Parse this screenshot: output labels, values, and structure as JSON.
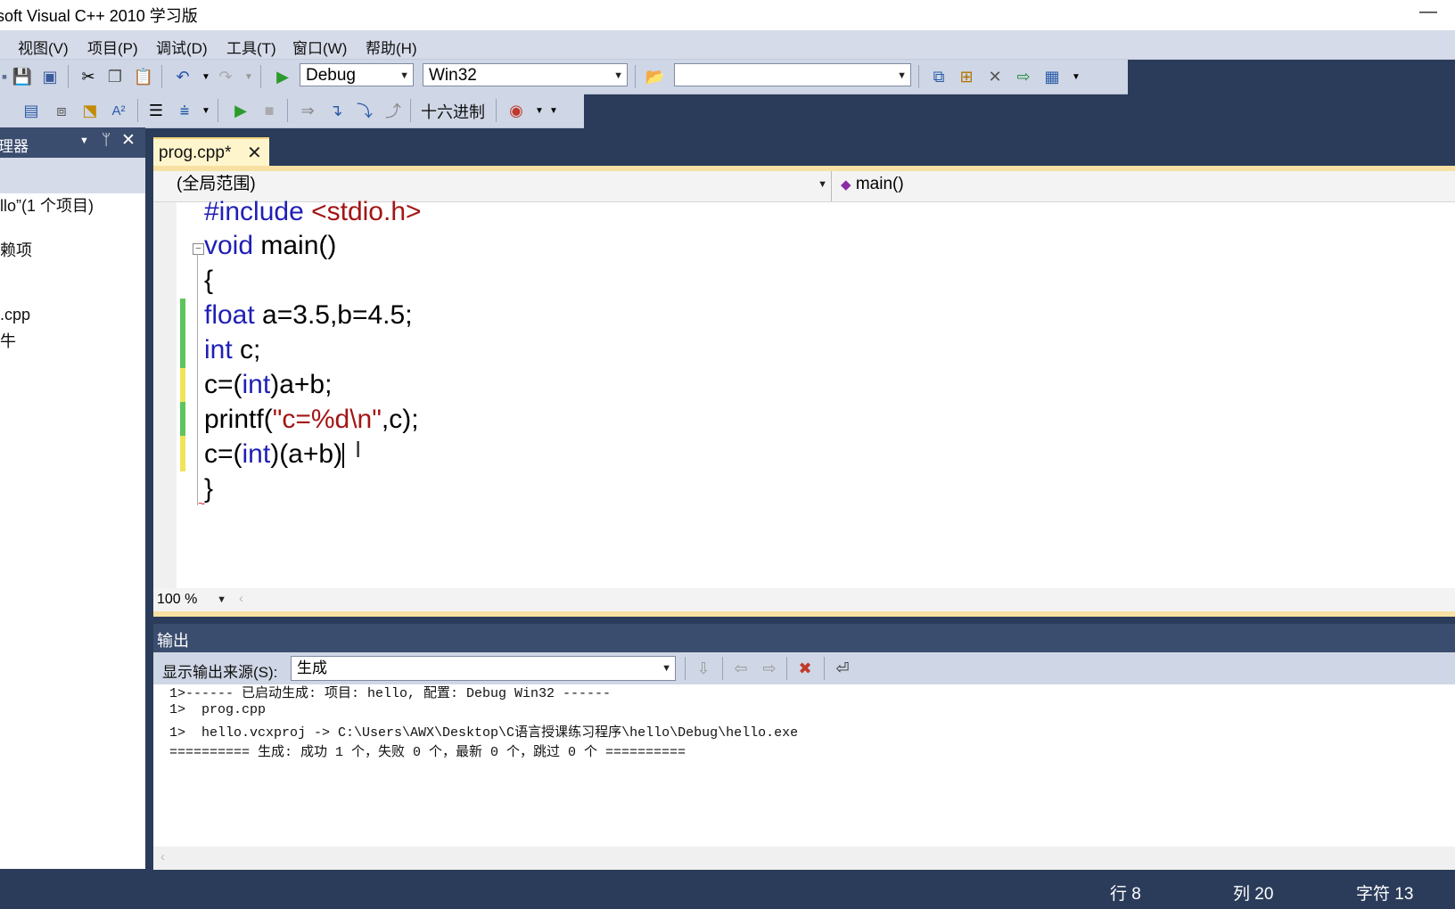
{
  "window": {
    "title": "soft Visual C++ 2010 学习版",
    "minimize": "—"
  },
  "menu": [
    "视图(V)",
    "项目(P)",
    "调试(D)",
    "工具(T)",
    "窗口(W)",
    "帮助(H)"
  ],
  "toolbar": {
    "config": "Debug",
    "platform": "Win32",
    "find_value": "",
    "hex_label": "十六进制"
  },
  "solution_explorer": {
    "title": "理器",
    "items": [
      "llo”(1 个项目)",
      "赖项",
      ".cpp",
      "牛"
    ]
  },
  "editor": {
    "tab": "prog.cpp*",
    "scope": "(全局范围)",
    "member": "main()",
    "zoom": "100 %",
    "lines": [
      {
        "pre": "#include ",
        "inc": "<stdio.h>"
      },
      {
        "kw": "void",
        "rest": " main()"
      },
      {
        "text": "{"
      },
      {
        "kw": "float",
        "rest": " a=3.5,b=4.5;"
      },
      {
        "kw": "int",
        "rest": " c;"
      },
      {
        "a": "c=(",
        "kw": "int",
        "b": ")a+b;"
      },
      {
        "a": "printf(",
        "str": "\"c=%d\\n\"",
        "b": ",c);"
      },
      {
        "a": "c=(",
        "kw": "int",
        "b": ")(a+b)"
      },
      {
        "text": "}"
      }
    ]
  },
  "output": {
    "title": "输出",
    "source_label": "显示输出来源(S):",
    "source_value": "生成",
    "lines": [
      "1>------ 已启动生成: 项目: hello, 配置: Debug Win32 ------",
      "1>  prog.cpp",
      "1>  hello.vcxproj -> C:\\Users\\AWX\\Desktop\\C语言授课练习程序\\hello\\Debug\\hello.exe",
      "========== 生成: 成功 1 个，失败 0 个，最新 0 个，跳过 0 个 =========="
    ]
  },
  "status": {
    "line": "行 8",
    "col": "列 20",
    "char": "字符 13"
  },
  "colors": {
    "keyword": "#1f1fb5",
    "string": "#a31515",
    "frame": "#2b3c5a",
    "accent": "#f7e1a2"
  }
}
